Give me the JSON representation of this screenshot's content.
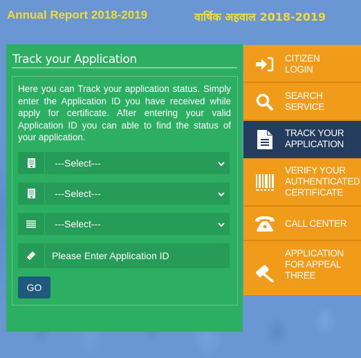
{
  "header": {
    "annual_report_en": "Annual Report 2018-2019",
    "annual_report_hi": "वार्षिक अहवाल 2018-2019"
  },
  "track_panel": {
    "title": "Track your Application",
    "description": "Here you can Track your application status. Simply enter the Application ID you have received while apply for certificate. After entering your valid Application ID you can able to find the status of your application.",
    "selects": [
      {
        "icon": "document-icon",
        "value": "---Select---"
      },
      {
        "icon": "document-icon",
        "value": "---Select---"
      },
      {
        "icon": "list-icon",
        "value": "---Select---"
      }
    ],
    "application_id": {
      "icon": "ticket-icon",
      "value": "",
      "placeholder": "Please Enter Application ID"
    },
    "go_label": "GO"
  },
  "sidebar": {
    "items": [
      {
        "label": "CITIZEN\nLOGIN",
        "icon": "sign-in-icon",
        "active": false
      },
      {
        "label": "SEARCH\nSERVICE",
        "icon": "search-icon",
        "active": false
      },
      {
        "label": "TRACK YOUR\nAPPLICATION",
        "icon": "file-text-icon",
        "active": true
      },
      {
        "label": "VERIFY YOUR\nAUTHENTICATED\nCERTIFICATE",
        "icon": "barcode-icon",
        "active": false
      },
      {
        "label": "CALL CENTER",
        "icon": "phone-icon",
        "active": false
      },
      {
        "label": "APPLICATION\nFOR APPEAL\nTHREE",
        "icon": "gavel-icon",
        "active": false
      }
    ]
  },
  "colors": {
    "page_bg": "#6a97d4",
    "header_text": "#f2dc2e",
    "panel_green": "#2cae63",
    "sidebar_orange": "#f09c1a",
    "sidebar_active": "#243d5f",
    "go_button": "#1f5a7c"
  }
}
